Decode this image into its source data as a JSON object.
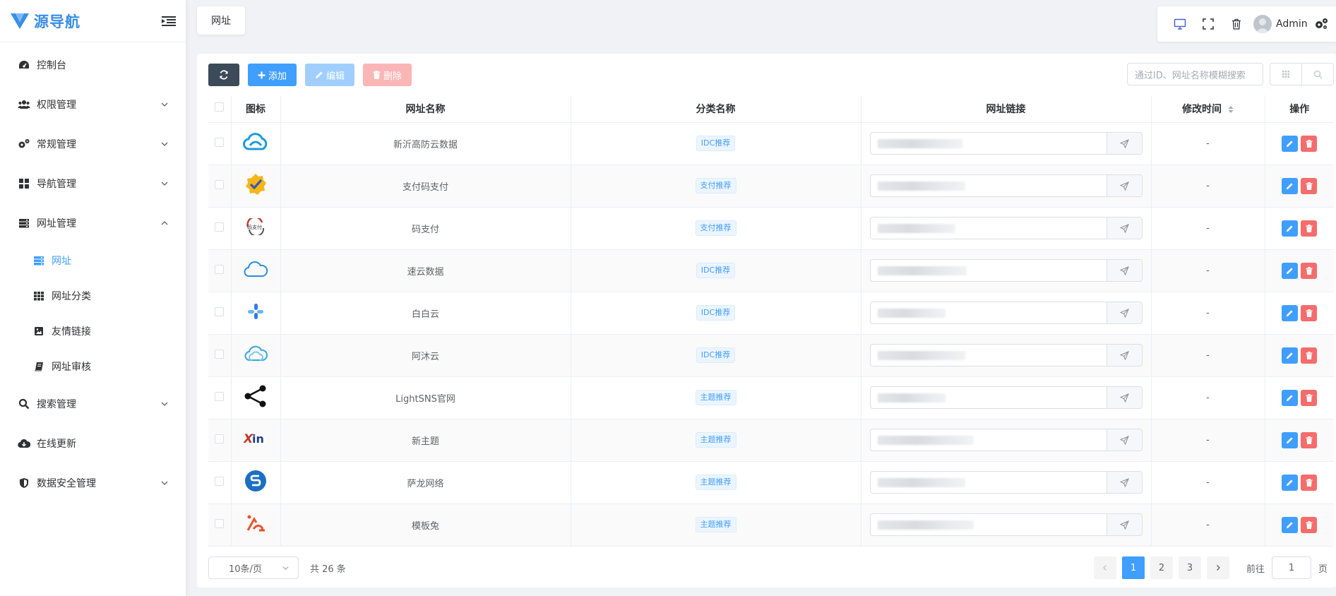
{
  "app": {
    "logo_text": "源导航"
  },
  "sidebar": {
    "items": [
      {
        "label": "控制台",
        "icon": "dashboard-icon"
      },
      {
        "label": "权限管理",
        "icon": "users-icon"
      },
      {
        "label": "常规管理",
        "icon": "cogs-icon"
      },
      {
        "label": "导航管理",
        "icon": "grid-icon"
      },
      {
        "label": "网址管理",
        "icon": "server-icon"
      },
      {
        "label": "搜索管理",
        "icon": "search-icon"
      },
      {
        "label": "在线更新",
        "icon": "cloud-download-icon"
      },
      {
        "label": "数据安全管理",
        "icon": "shield-icon"
      }
    ],
    "submenu": [
      {
        "label": "网址",
        "icon": "server-icon"
      },
      {
        "label": "网址分类",
        "icon": "th-icon"
      },
      {
        "label": "友情链接",
        "icon": "image-icon"
      },
      {
        "label": "网址审核",
        "icon": "book-icon"
      }
    ]
  },
  "tabs": {
    "current": "网址"
  },
  "header": {
    "user": "Admin"
  },
  "toolbar": {
    "add_label": "添加",
    "edit_label": "编辑",
    "delete_label": "删除",
    "search_placeholder": "通过ID、网址名称模糊搜索"
  },
  "table": {
    "headers": {
      "icon": "图标",
      "name": "网址名称",
      "category": "分类名称",
      "url": "网址链接",
      "mtime": "修改时间",
      "ops": "操作"
    },
    "rows": [
      {
        "name": "新沂高防云数据",
        "category": "IDC推荐",
        "mtime": "-",
        "icon": "cloud-logo-icon"
      },
      {
        "name": "支付码支付",
        "category": "支付推荐",
        "mtime": "-",
        "icon": "badge-check-logo-icon"
      },
      {
        "name": "码支付",
        "category": "支付推荐",
        "mtime": "-",
        "icon": "codepay-logo-icon"
      },
      {
        "name": "速云数据",
        "category": "IDC推荐",
        "mtime": "-",
        "icon": "cloud-outline-logo-icon"
      },
      {
        "name": "白白云",
        "category": "IDC推荐",
        "mtime": "-",
        "icon": "cross-logo-icon"
      },
      {
        "name": "阿沐云",
        "category": "IDC推荐",
        "mtime": "-",
        "icon": "cloud-double-logo-icon"
      },
      {
        "name": "LightSNS官网",
        "category": "主题推荐",
        "mtime": "-",
        "icon": "share-logo-icon"
      },
      {
        "name": "新主题",
        "category": "主题推荐",
        "mtime": "-",
        "icon": "xin-logo-icon"
      },
      {
        "name": "萨龙网络",
        "category": "主题推荐",
        "mtime": "-",
        "icon": "s-circle-logo-icon"
      },
      {
        "name": "模板兔",
        "category": "主题推荐",
        "mtime": "-",
        "icon": "mobantu-logo-icon"
      }
    ]
  },
  "pagination": {
    "page_size": "10条/页",
    "total": "共 26 条",
    "pages": [
      "1",
      "2",
      "3"
    ],
    "current": "1",
    "goto_prefix": "前往",
    "goto_value": "1",
    "goto_suffix": "页"
  },
  "colors": {
    "primary": "#409eff",
    "danger": "#f56c6c",
    "dark": "#3c4a5a"
  }
}
